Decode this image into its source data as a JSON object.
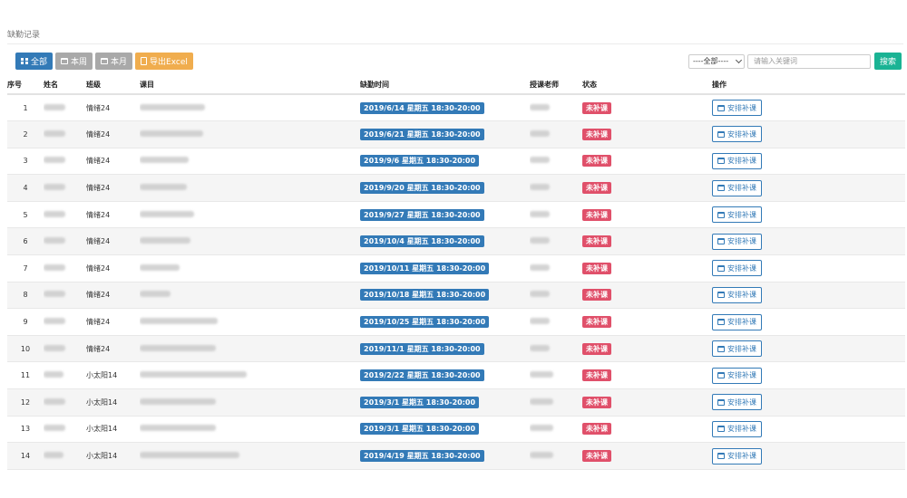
{
  "page": {
    "title": "缺勤记录"
  },
  "toolbar": {
    "all_label": "全部",
    "week_label": "本周",
    "month_label": "本月",
    "export_label": "导出Excel"
  },
  "filter": {
    "select_value": "----全部----",
    "search_placeholder": "请输入关键词",
    "search_label": "搜索"
  },
  "table": {
    "headers": [
      "序号",
      "姓名",
      "班级",
      "课目",
      "缺勤时间",
      "授课老师",
      "状态",
      "操作"
    ],
    "rows": [
      {
        "index": "1",
        "class": "情绪24",
        "time": "2019/6/14 星期五 18:30-20:00",
        "status": "未补课",
        "action": "安排补课"
      },
      {
        "index": "2",
        "class": "情绪24",
        "time": "2019/6/21 星期五 18:30-20:00",
        "status": "未补课",
        "action": "安排补课"
      },
      {
        "index": "3",
        "class": "情绪24",
        "time": "2019/9/6 星期五 18:30-20:00",
        "status": "未补课",
        "action": "安排补课"
      },
      {
        "index": "4",
        "class": "情绪24",
        "time": "2019/9/20 星期五 18:30-20:00",
        "status": "未补课",
        "action": "安排补课"
      },
      {
        "index": "5",
        "class": "情绪24",
        "time": "2019/9/27 星期五 18:30-20:00",
        "status": "未补课",
        "action": "安排补课"
      },
      {
        "index": "6",
        "class": "情绪24",
        "time": "2019/10/4 星期五 18:30-20:00",
        "status": "未补课",
        "action": "安排补课"
      },
      {
        "index": "7",
        "class": "情绪24",
        "time": "2019/10/11 星期五 18:30-20:00",
        "status": "未补课",
        "action": "安排补课"
      },
      {
        "index": "8",
        "class": "情绪24",
        "time": "2019/10/18 星期五 18:30-20:00",
        "status": "未补课",
        "action": "安排补课"
      },
      {
        "index": "9",
        "class": "情绪24",
        "time": "2019/10/25 星期五 18:30-20:00",
        "status": "未补课",
        "action": "安排补课"
      },
      {
        "index": "10",
        "class": "情绪24",
        "time": "2019/11/1 星期五 18:30-20:00",
        "status": "未补课",
        "action": "安排补课"
      },
      {
        "index": "11",
        "class": "小太阳14",
        "time": "2019/2/22 星期五 18:30-20:00",
        "status": "未补课",
        "action": "安排补课"
      },
      {
        "index": "12",
        "class": "小太阳14",
        "time": "2019/3/1 星期五 18:30-20:00",
        "status": "未补课",
        "action": "安排补课"
      },
      {
        "index": "13",
        "class": "小太阳14",
        "time": "2019/3/1 星期五 18:30-20:00",
        "status": "未补课",
        "action": "安排补课"
      },
      {
        "index": "14",
        "class": "小太阳14",
        "time": "2019/4/19 星期五 18:30-20:00",
        "status": "未补课",
        "action": "安排补课"
      }
    ]
  },
  "colors": {
    "primary": "#337ab7",
    "gray_button": "#a9a9a9",
    "export_button": "#f0ad4e",
    "search_button": "#1ab394",
    "status_badge": "#e0506a"
  },
  "icons": {
    "all": "grid-icon",
    "week": "calendar-icon",
    "month": "calendar-icon",
    "export": "file-icon",
    "action": "calendar-icon"
  }
}
